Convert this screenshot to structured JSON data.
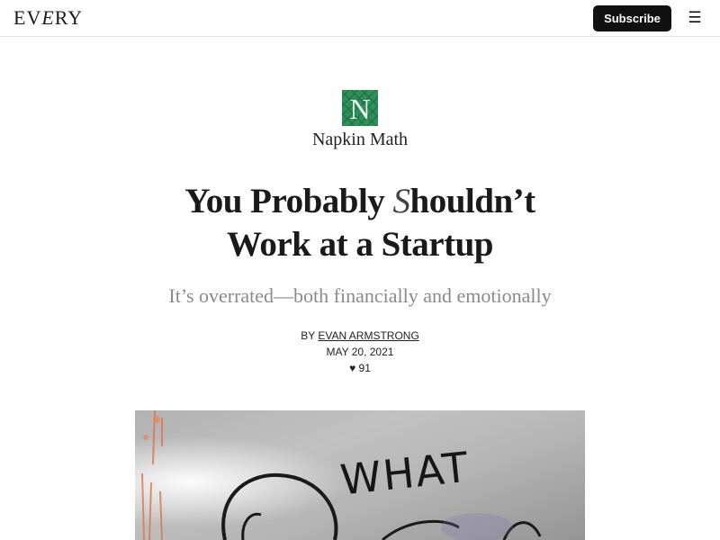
{
  "header": {
    "logo_prefix": "EV",
    "logo_italic": "E",
    "logo_suffix": "RY",
    "subscribe_label": "Subscribe",
    "menu_icon": "hamburger-menu-icon",
    "menu_glyph": "☰"
  },
  "publication": {
    "logo_letter": "N",
    "name": "Napkin Math",
    "brand_color": "#2f8f5b"
  },
  "article": {
    "title_part1": "You Probably ",
    "title_swash": "S",
    "title_part2": "houldn’t",
    "title_line2": "Work at a Startup",
    "subtitle": "It’s overrated—both financially and emotionally",
    "by_label": "BY ",
    "author": "EVAN ARMSTRONG",
    "date": "MAY 20, 2021",
    "heart_glyph": "♥",
    "likes": "91"
  },
  "hero": {
    "graffiti_text": "WHAT"
  }
}
